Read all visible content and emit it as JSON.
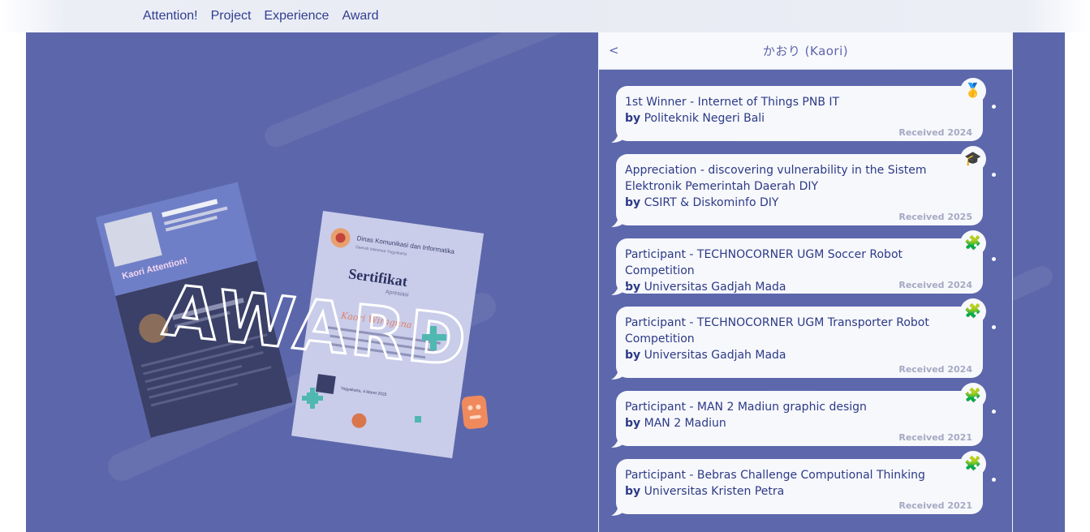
{
  "nav": {
    "items": [
      "Attention!",
      "Project",
      "Experience",
      "Award"
    ]
  },
  "hero": {
    "word": "AWARD",
    "certificate": {
      "org": "Dinas Komunikasi dan Informatika",
      "org_sub": "Daerah Istimewa Yogyakarta",
      "title": "Sertifikat",
      "subtitle": "Apresiasi",
      "recipient": "Kaori Wiraguna",
      "place_date": "Yogyakarta, 4 Maret 2025"
    },
    "screenshot_caption": "Kaori Attention!"
  },
  "panel": {
    "back_label": "<",
    "title": "かおり (Kaori)",
    "by_prefix": "by",
    "awards": [
      {
        "title": "1st Winner - Internet of Things PNB IT",
        "by": "Politeknik Negeri Bali",
        "received": "Received 2024",
        "icon": "medal-icon"
      },
      {
        "title": "Appreciation - discovering vulnerability in the Sistem Elektronik Pemerintah Daerah DIY",
        "by": "CSIRT & Diskominfo DIY",
        "received": "Received 2025",
        "icon": "graduation-cap-icon"
      },
      {
        "title": "Participant - TECHNOCORNER UGM Soccer Robot Competition",
        "by": "Universitas Gadjah Mada",
        "received": "Received 2024",
        "icon": "puzzle-icon"
      },
      {
        "title": "Participant - TECHNOCORNER UGM Transporter Robot Competition",
        "by": "Universitas Gadjah Mada",
        "received": "Received 2024",
        "icon": "puzzle-icon"
      },
      {
        "title": "Participant - MAN 2 Madiun graphic design",
        "by": "MAN 2 Madiun",
        "received": "Received 2021",
        "icon": "puzzle-icon"
      },
      {
        "title": "Participant - Bebras Challenge Computional Thinking",
        "by": "Universitas Kristen Petra",
        "received": "Received 2021",
        "icon": "puzzle-icon"
      }
    ]
  },
  "colors": {
    "stage": "#5c67ab",
    "nav_text": "#2f3e8f",
    "card_bg": "#f7f8fc",
    "card_text": "#2c3a86",
    "muted": "#a5a9c2",
    "accent_teal": "#4fb8b0",
    "accent_orange": "#f08a5d"
  }
}
